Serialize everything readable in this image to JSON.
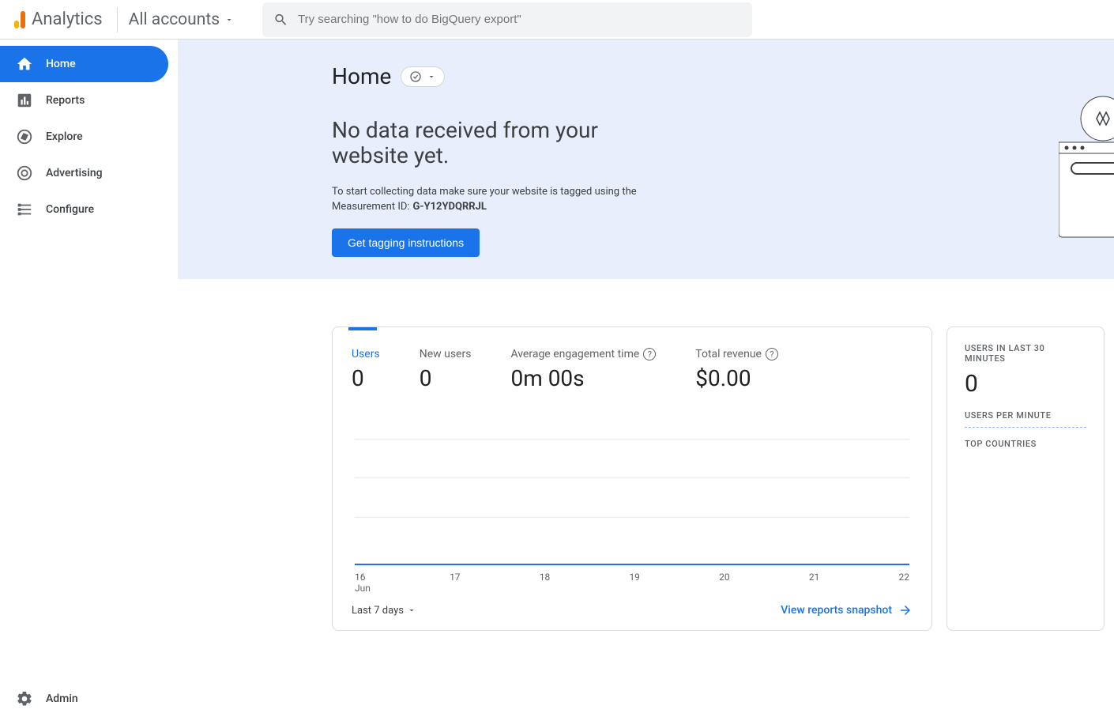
{
  "header": {
    "product": "Analytics",
    "accounts_label": "All accounts",
    "search_placeholder": "Try searching \"how to do BigQuery export\""
  },
  "sidebar": {
    "items": [
      {
        "label": "Home",
        "icon": "home-icon",
        "active": true
      },
      {
        "label": "Reports",
        "icon": "reports-icon",
        "active": false
      },
      {
        "label": "Explore",
        "icon": "explore-icon",
        "active": false
      },
      {
        "label": "Advertising",
        "icon": "advertising-icon",
        "active": false
      },
      {
        "label": "Configure",
        "icon": "configure-icon",
        "active": false
      }
    ],
    "admin_label": "Admin"
  },
  "hero": {
    "title": "Home",
    "no_data_heading": "No data received from your website yet.",
    "desc_prefix": "To start collecting data make sure your website is tagged using the",
    "measurement_label": "Measurement ID:",
    "measurement_id": "G-Y12YDQRRJL",
    "cta": "Get tagging instructions"
  },
  "main_card": {
    "metrics": [
      {
        "label": "Users",
        "value": "0",
        "active": true,
        "help": false
      },
      {
        "label": "New users",
        "value": "0",
        "active": false,
        "help": false
      },
      {
        "label": "Average engagement time",
        "value": "0m 00s",
        "active": false,
        "help": true
      },
      {
        "label": "Total revenue",
        "value": "$0.00",
        "active": false,
        "help": true
      }
    ],
    "range_label": "Last 7 days",
    "snapshot_link": "View reports snapshot"
  },
  "side_card": {
    "users_30_label": "USERS IN LAST 30 MINUTES",
    "users_30_value": "0",
    "users_per_min_label": "USERS PER MINUTE",
    "top_countries_label": "TOP COUNTRIES"
  },
  "chart_data": {
    "type": "line",
    "title": "",
    "xlabel": "Jun",
    "ylabel": "",
    "ylim": [
      0,
      1
    ],
    "categories": [
      "16",
      "17",
      "18",
      "19",
      "20",
      "21",
      "22"
    ],
    "series": [
      {
        "name": "Users",
        "values": [
          0,
          0,
          0,
          0,
          0,
          0,
          0
        ]
      }
    ]
  }
}
